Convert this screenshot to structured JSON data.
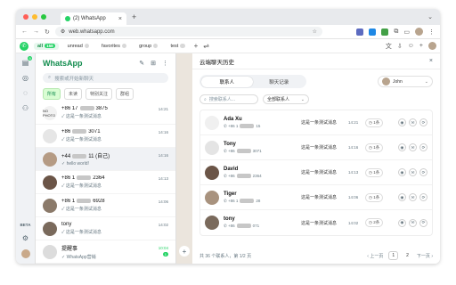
{
  "browser": {
    "tab_title": "(2) WhatsApp",
    "url": "web.whatsapp.com",
    "traffic_colors": [
      "#ff5f57",
      "#febc2e",
      "#28c840"
    ]
  },
  "wa_tabs": [
    {
      "label": "all",
      "count": "158",
      "active": true
    },
    {
      "label": "unread",
      "count": "",
      "active": false
    },
    {
      "label": "favorites",
      "count": "",
      "active": false
    },
    {
      "label": "group",
      "count": "",
      "active": false
    },
    {
      "label": "test",
      "count": "",
      "active": false
    }
  ],
  "rail": {
    "chat_badge": "9",
    "beta_label": "BETA"
  },
  "chatlist": {
    "title": "WhatsApp",
    "search_placeholder": "搜索或开始新聊天",
    "filters": [
      {
        "label": "所有",
        "on": true
      },
      {
        "label": "未读",
        "on": false
      },
      {
        "label": "特别关注",
        "on": false
      },
      {
        "label": "群组",
        "on": false
      }
    ],
    "chats": [
      {
        "name": "+86 17",
        "name_tail": "3875",
        "msg": "这是一条测试消息",
        "time": "14:21",
        "avatar": "#f2f2f2",
        "avatar_text": "NO PHOTO",
        "selected": false
      },
      {
        "name": "+86",
        "name_tail": "3071",
        "msg": "这是一条测试消息",
        "time": "14:16",
        "avatar": "#e6e6e6",
        "avatar_text": "",
        "selected": false
      },
      {
        "name": "+44",
        "name_tail": "11 (自己)",
        "msg": "hello world!",
        "time": "14:16",
        "avatar": "#b59b84",
        "avatar_text": "",
        "selected": true
      },
      {
        "name": "+86 1",
        "name_tail": "2364",
        "msg": "这是一条测试消息",
        "time": "14:13",
        "avatar": "#6b5547",
        "avatar_text": "",
        "selected": false
      },
      {
        "name": "+86 1",
        "name_tail": "6928",
        "msg": "这是一条测试消息",
        "time": "14:06",
        "avatar": "#8b7a6a",
        "avatar_text": "",
        "selected": false
      },
      {
        "name": "tony",
        "name_tail": "",
        "msg": "这是一条测试消息",
        "time": "14:02",
        "avatar": "#7a6a5c",
        "avatar_text": "",
        "selected": false
      },
      {
        "name": "提醒事",
        "name_tail": "",
        "msg": "WhatsApp营销",
        "time": "10:04",
        "avatar": "#dcdcdc",
        "avatar_text": "",
        "selected": false,
        "unread": "1",
        "time_green": true
      }
    ]
  },
  "panel": {
    "title": "云端聊天历史",
    "seg_contacts": "联系人",
    "seg_history": "聊天记录",
    "account": "John",
    "contact_search_placeholder": "搜索联系人...",
    "contact_filter": "全部联系人",
    "rows": [
      {
        "name": "Ada Xu",
        "phone": "+86 1",
        "phone_tail": "15",
        "last": "这是一条测试消息",
        "time": "14:21",
        "count": "1条",
        "avatar": "#f0f0f0"
      },
      {
        "name": "Tony",
        "phone": "+86",
        "phone_tail": "3071",
        "last": "这是一条测试消息",
        "time": "14:16",
        "count": "1条",
        "avatar": "#e4e4e4"
      },
      {
        "name": "David",
        "phone": "+86",
        "phone_tail": "2364",
        "last": "这是一条测试消息",
        "time": "14:13",
        "count": "1条",
        "avatar": "#6b5547"
      },
      {
        "name": "Tiger",
        "phone": "+86 1",
        "phone_tail": "28",
        "last": "这是一条测试消息",
        "time": "14:06",
        "count": "1条",
        "avatar": "#a8927e"
      },
      {
        "name": "tony",
        "phone": "+86",
        "phone_tail": "071",
        "last": "这是一条测试消息",
        "time": "14:02",
        "count": "2条",
        "avatar": "#7a6a5c"
      }
    ],
    "summary": "共 36 个联系人，第 1/2 页",
    "prev": "上一页",
    "next": "下一页",
    "pages": [
      "1",
      "2"
    ]
  }
}
